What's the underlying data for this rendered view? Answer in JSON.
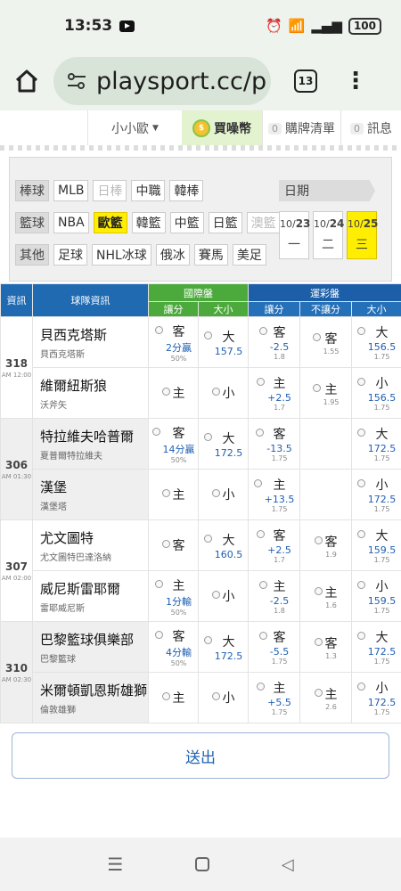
{
  "status": {
    "time": "13:53",
    "battery": "100"
  },
  "browser": {
    "url": "playsport.cc/p",
    "tab_count": "13"
  },
  "topnav": {
    "user": "小小歐",
    "coin_label": "買噪幣",
    "cart_label": "購牌清單",
    "cart_count": "0",
    "msg_label": "訊息",
    "msg_count": "0"
  },
  "filters": {
    "row1_label": "棒球",
    "row1": [
      "MLB",
      "日棒",
      "中職",
      "韓棒"
    ],
    "row2_label": "籃球",
    "row2": [
      "NBA",
      "歐籃",
      "韓籃",
      "中籃",
      "日籃",
      "澳籃"
    ],
    "row3_label": "其他",
    "row3": [
      "足球",
      "NHL冰球",
      "俄冰",
      "賽馬",
      "美足"
    ],
    "date_label": "日期",
    "dates": [
      {
        "m": "10/",
        "d": "23",
        "w": "一"
      },
      {
        "m": "10/",
        "d": "24",
        "w": "二"
      },
      {
        "m": "10/",
        "d": "25",
        "w": "三"
      }
    ]
  },
  "table": {
    "h_info": "資訊",
    "h_team": "球隊資訊",
    "h_intl": "國際盤",
    "h_sport": "運彩盤",
    "sub": [
      "讓分",
      "大小",
      "讓分",
      "不讓分",
      "大小"
    ],
    "games": [
      {
        "num": "318",
        "time": "AM 12:00",
        "rows": [
          {
            "team": "貝西克塔斯",
            "alt": "貝西克塔斯",
            "i1": {
              "t": "客",
              "v": "2分贏",
              "s": "50%"
            },
            "i2": {
              "t": "大",
              "v": "157.5",
              "s": ""
            },
            "s1": {
              "t": "客",
              "v": "-2.5",
              "s": "1.8"
            },
            "s2": {
              "t": "客",
              "v": "",
              "s": "1.55"
            },
            "s3": {
              "t": "大",
              "v": "156.5",
              "s": "1.75"
            }
          },
          {
            "team": "維爾紐斯狼",
            "alt": "沃斧矢",
            "i1": {
              "t": "主",
              "v": "",
              "s": ""
            },
            "i2": {
              "t": "小",
              "v": "",
              "s": ""
            },
            "s1": {
              "t": "主",
              "v": "+2.5",
              "s": "1.7"
            },
            "s2": {
              "t": "主",
              "v": "",
              "s": "1.95"
            },
            "s3": {
              "t": "小",
              "v": "156.5",
              "s": "1.75"
            }
          }
        ]
      },
      {
        "num": "306",
        "time": "AM 01:30",
        "rows": [
          {
            "team": "特拉維夫哈普爾",
            "alt": "夏普爾特拉維夫",
            "i1": {
              "t": "客",
              "v": "14分贏",
              "s": "50%"
            },
            "i2": {
              "t": "大",
              "v": "172.5",
              "s": ""
            },
            "s1": {
              "t": "客",
              "v": "-13.5",
              "s": "1.75"
            },
            "s2": {
              "t": "",
              "v": "",
              "s": ""
            },
            "s3": {
              "t": "大",
              "v": "172.5",
              "s": "1.75"
            }
          },
          {
            "team": "漢堡",
            "alt": "漢堡塔",
            "i1": {
              "t": "主",
              "v": "",
              "s": ""
            },
            "i2": {
              "t": "小",
              "v": "",
              "s": ""
            },
            "s1": {
              "t": "主",
              "v": "+13.5",
              "s": "1.75"
            },
            "s2": {
              "t": "",
              "v": "",
              "s": ""
            },
            "s3": {
              "t": "小",
              "v": "172.5",
              "s": "1.75"
            }
          }
        ]
      },
      {
        "num": "307",
        "time": "AM 02:00",
        "rows": [
          {
            "team": "尤文圖特",
            "alt": "尤文圖特巴達洛納",
            "i1": {
              "t": "客",
              "v": "",
              "s": ""
            },
            "i2": {
              "t": "大",
              "v": "160.5",
              "s": ""
            },
            "s1": {
              "t": "客",
              "v": "+2.5",
              "s": "1.7"
            },
            "s2": {
              "t": "客",
              "v": "",
              "s": "1.9"
            },
            "s3": {
              "t": "大",
              "v": "159.5",
              "s": "1.75"
            }
          },
          {
            "team": "威尼斯雷耶爾",
            "alt": "雷耶威尼斯",
            "i1": {
              "t": "主",
              "v": "1分輸",
              "s": "50%"
            },
            "i2": {
              "t": "小",
              "v": "",
              "s": ""
            },
            "s1": {
              "t": "主",
              "v": "-2.5",
              "s": "1.8"
            },
            "s2": {
              "t": "主",
              "v": "",
              "s": "1.6"
            },
            "s3": {
              "t": "小",
              "v": "159.5",
              "s": "1.75"
            }
          }
        ]
      },
      {
        "num": "310",
        "time": "AM 02:30",
        "rows": [
          {
            "team": "巴黎籃球俱樂部",
            "alt": "巴黎籃球",
            "i1": {
              "t": "客",
              "v": "4分輸",
              "s": "50%"
            },
            "i2": {
              "t": "大",
              "v": "172.5",
              "s": ""
            },
            "s1": {
              "t": "客",
              "v": "-5.5",
              "s": "1.75"
            },
            "s2": {
              "t": "客",
              "v": "",
              "s": "1.3"
            },
            "s3": {
              "t": "大",
              "v": "172.5",
              "s": "1.75"
            }
          },
          {
            "team": "米爾頓凱恩斯雄獅",
            "alt": "倫敦雄獅",
            "i1": {
              "t": "主",
              "v": "",
              "s": ""
            },
            "i2": {
              "t": "小",
              "v": "",
              "s": ""
            },
            "s1": {
              "t": "主",
              "v": "+5.5",
              "s": "1.75"
            },
            "s2": {
              "t": "主",
              "v": "",
              "s": "2.6"
            },
            "s3": {
              "t": "小",
              "v": "172.5",
              "s": "1.75"
            }
          }
        ]
      }
    ]
  },
  "submit_label": "送出"
}
